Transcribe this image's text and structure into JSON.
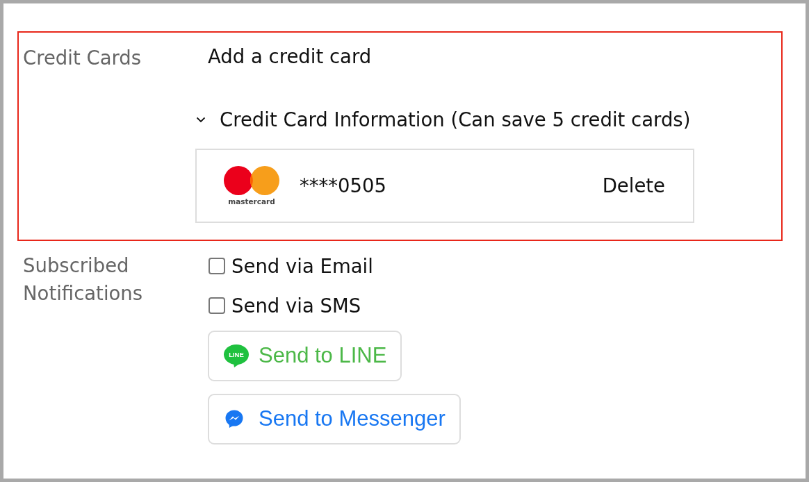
{
  "sections": [
    {
      "kind": "credit_cards",
      "label": "Credit Cards",
      "highlighted": true,
      "add_link": "Add a credit card",
      "card_info": {
        "title": "Credit Card Information (Can save 5 credit cards)",
        "expanded": true,
        "cards": [
          {
            "kind": "mastercard",
            "logo_text": "mastercard",
            "number": "****0505",
            "action": "Delete"
          }
        ]
      }
    },
    {
      "kind": "notifications",
      "label": "Subscribed Notifications",
      "options": [
        {
          "label": "Send via Email",
          "checked": false
        },
        {
          "label": "Send via SMS",
          "checked": false
        }
      ],
      "buttons": [
        {
          "kind": "line",
          "icon_text": "LINE",
          "label": "Send to LINE"
        },
        {
          "kind": "messenger",
          "label": "Send to Messenger"
        }
      ]
    }
  ]
}
